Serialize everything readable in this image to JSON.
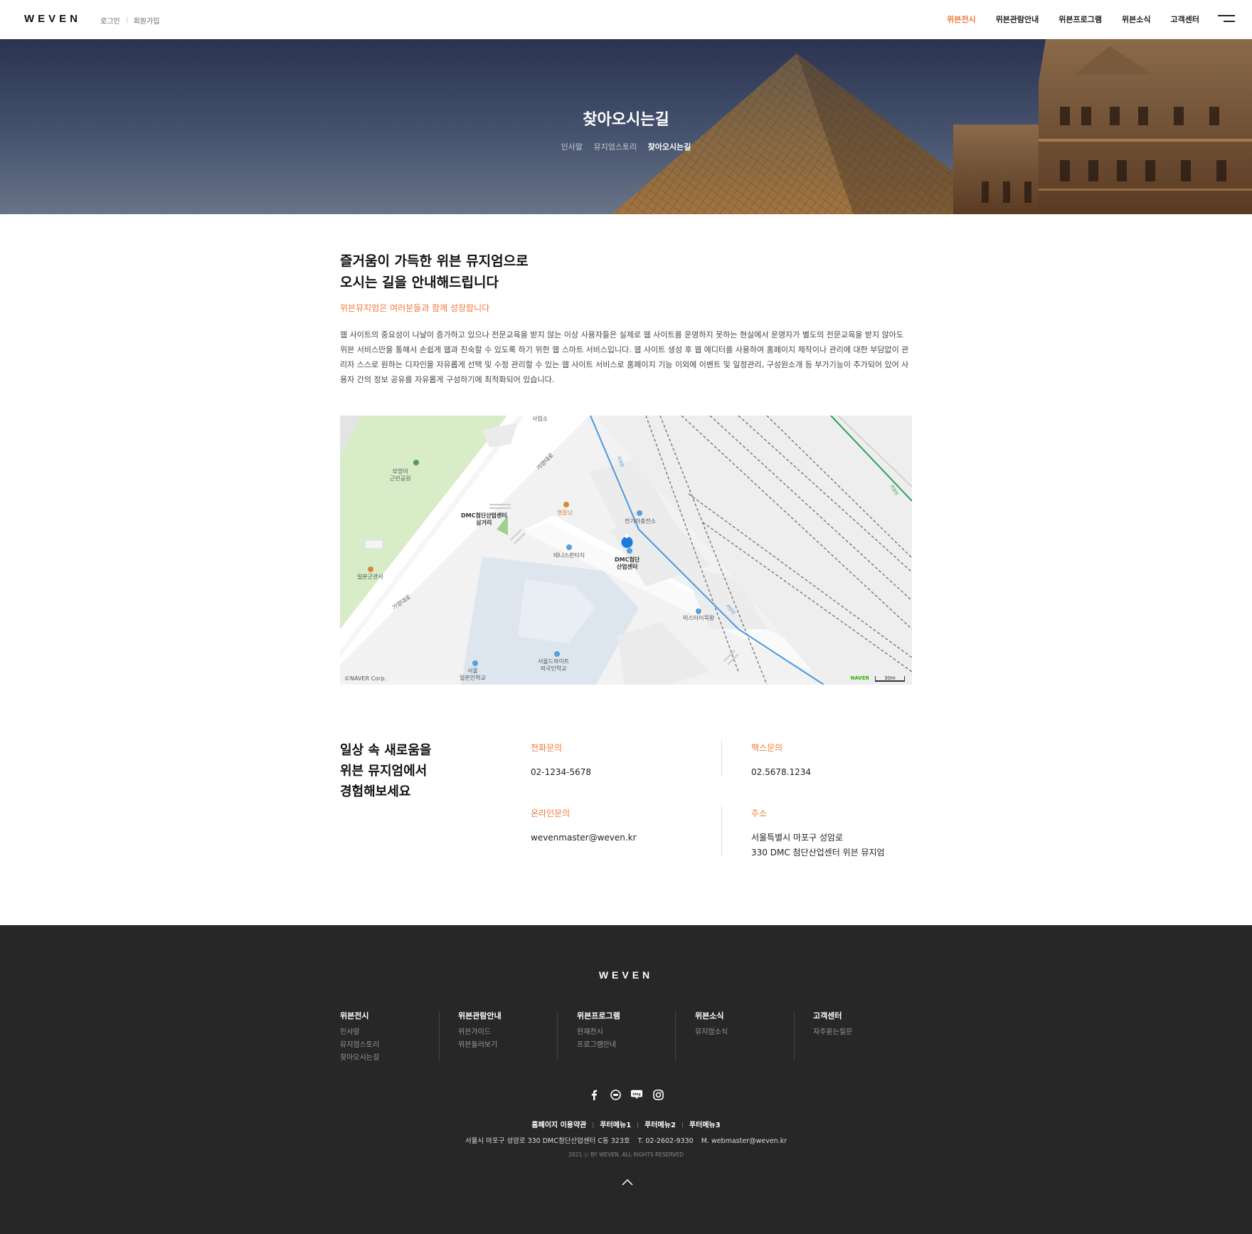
{
  "header": {
    "logo": "WEVEN",
    "login": "로그인",
    "join": "회원가입",
    "nav": [
      "위븐전시",
      "위븐관람안내",
      "위븐프로그램",
      "위븐소식",
      "고객센터"
    ],
    "active_index": 0
  },
  "hero": {
    "title": "찾아오시는길",
    "subnav": [
      "인사말",
      "뮤지엄스토리",
      "찾아오시는길"
    ]
  },
  "intro": {
    "heading_line1": "즐거움이 가득한 위븐 뮤지엄으로",
    "heading_line2": "오시는 길을 안내해드립니다",
    "accent": "위븐뮤지엄은 여러분들과 함께 성장합니다",
    "body": "웹 사이트의 중요성이 나날이 증가하고 있으나 전문교육을 받지 않는 이상 사용자들은 실제로 웹 사이트를 운영하지 못하는 현실에서 운영자가 별도의 전문교육을 받지 않아도 위븐 서비스만을 통해서 손쉽게 웹과 친숙할 수 있도록 하기 위한 웹 스마트 서비스입니다. 웹 사이트 생성 후 웹 에디터를 사용하여 홈페이지 제작이나 관리에 대한 부담없이 관리자 스스로 원하는 디자인을 자유롭게 선택 및 수정 관리할 수 있는 웹 사이트 서비스로 홈페이지 기능 이외에 이벤트 및 일정관리, 구성원소개 등 부가기능이 추가되어 있어 사용자 간의 정보 공유를 자유롭게 구성하기에 최적화되어 있습니다."
  },
  "map": {
    "labels": {
      "park": "부엉이\n근린공원",
      "junction": "DMC첨단산업센터\n삼거리",
      "road1": "가양대로",
      "road2": "가양대로",
      "top": "사업소",
      "cafe": "행들남",
      "power": "전기자충전소",
      "tennis": "테니스판타지",
      "center": "DMC첨단\n산업센터",
      "consulate": "일본군관사",
      "mister": "미스터어묵왕",
      "school1": "서울\n일본인학교",
      "school2": "서울드와이트\n외국인학교",
      "stream1": "귀양천",
      "stream2": "귀양천",
      "stream3": "귀양천"
    },
    "copyright": "©NAVER Corp.",
    "brand": "NAVER",
    "scale": "30m"
  },
  "contact": {
    "heading_line1": "일상 속 새로움을",
    "heading_line2": "위븐 뮤지엄에서",
    "heading_line3": "경험해보세요",
    "phone_label": "전화문의",
    "phone": "02-1234-5678",
    "fax_label": "팩스문의",
    "fax": "02.5678.1234",
    "online_label": "온라인문의",
    "email": "wevenmaster@weven.kr",
    "address_label": "주소",
    "address_line1": "서울특별시 마포구 성암로",
    "address_line2": "330 DMC 첨단산업센터 위븐 뮤지엄"
  },
  "footer": {
    "logo": "WEVEN",
    "columns": [
      {
        "title": "위븐전시",
        "items": [
          "인사말",
          "뮤지엄스토리",
          "찾아오시는길"
        ]
      },
      {
        "title": "위븐관람안내",
        "items": [
          "위븐가이드",
          "위븐둘러보기"
        ]
      },
      {
        "title": "위븐프로그램",
        "items": [
          "현재전시",
          "프로그램안내"
        ]
      },
      {
        "title": "위븐소식",
        "items": [
          "뮤지엄소식"
        ]
      },
      {
        "title": "고객센터",
        "items": [
          "자주묻는질문"
        ]
      }
    ],
    "social_icons": [
      "facebook-icon",
      "talk-icon",
      "blog-icon",
      "instagram-icon"
    ],
    "blog_text": "blog",
    "links": [
      "홈페이지 이용약관",
      "푸터메뉴1",
      "푸터메뉴2",
      "푸터메뉴3"
    ],
    "address": "서울시 마포구 성암로 330 DMC첨단산업센터 C동 323호",
    "tel": "T. 02-2602-9330",
    "mail": "M. webmaster@weven.kr",
    "copyright": "2021 ⓒ BY WEVEN. ALL RIGHTS RESERVED"
  },
  "colors": {
    "accent": "#f0783c",
    "footer_bg": "#272727"
  }
}
